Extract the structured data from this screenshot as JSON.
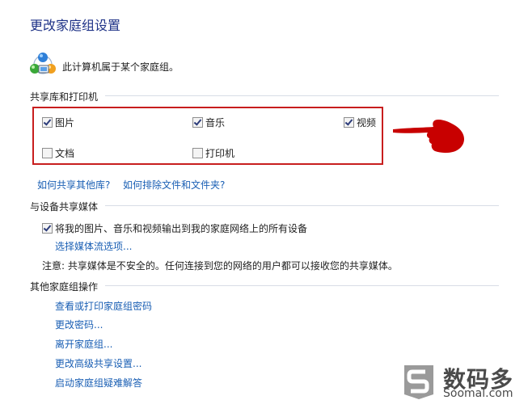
{
  "title": "更改家庭组设置",
  "membership": {
    "text": "此计算机属于某个家庭组。",
    "icon": "homegroup-computer-icon"
  },
  "libraries": {
    "heading": "共享库和打印机",
    "items": [
      {
        "label": "图片",
        "checked": true
      },
      {
        "label": "音乐",
        "checked": true
      },
      {
        "label": "视频",
        "checked": true
      },
      {
        "label": "文档",
        "checked": false
      },
      {
        "label": "打印机",
        "checked": false
      }
    ],
    "links": [
      "如何共享其他库?",
      "如何排除文件和文件夹?"
    ]
  },
  "media": {
    "heading": "与设备共享媒体",
    "checkbox_label": "将我的图片、音乐和视频输出到我的家庭网络上的所有设备",
    "checkbox_checked": true,
    "link": "选择媒体流选项...",
    "note": "注意: 共享媒体是不安全的。任何连接到您的网络的用户都可以接收您的共享媒体。"
  },
  "other": {
    "heading": "其他家庭组操作",
    "links": [
      "查看或打印家庭组密码",
      "更改密码...",
      "离开家庭组...",
      "更改高级共享设置...",
      "启动家庭组疑难解答"
    ]
  },
  "watermark": {
    "logo": "soomal-logo-icon",
    "cn": "数码多",
    "en": "Soomal.com"
  },
  "colors": {
    "title": "#1e3287",
    "link": "#1a5fb4",
    "highlight_box": "#c81e1e",
    "pointer_hand": "#c80000"
  }
}
